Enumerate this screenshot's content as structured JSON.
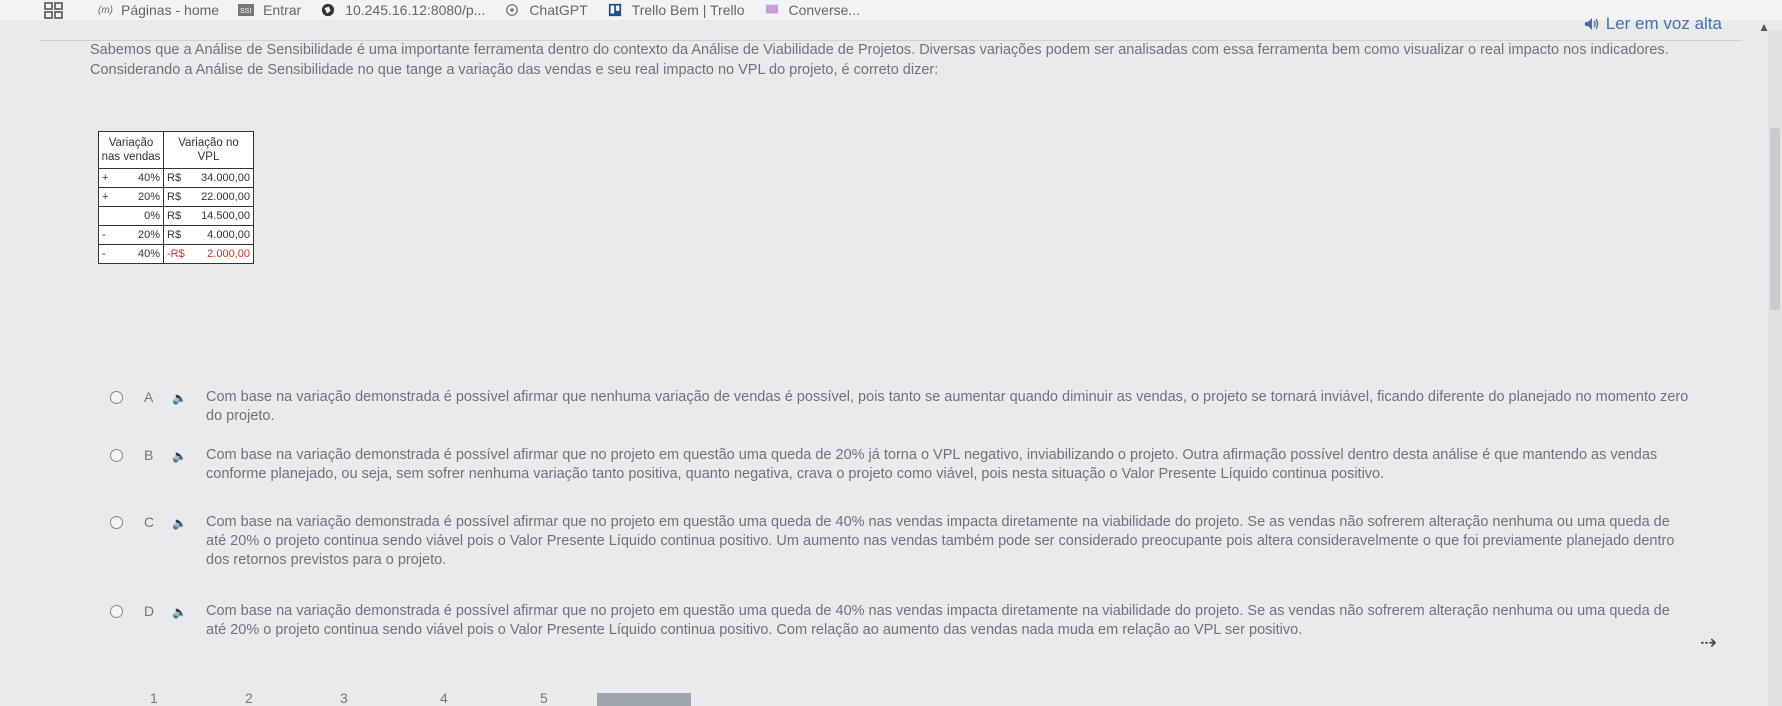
{
  "bookmarks": {
    "items": [
      {
        "label": "Páginas - home",
        "prefix": "(m)"
      },
      {
        "label": "Entrar"
      },
      {
        "label": "10.245.16.12:8080/p..."
      },
      {
        "label": "ChatGPT"
      },
      {
        "label": "Trello Bem | Trello"
      },
      {
        "label": "Converse..."
      }
    ]
  },
  "header": {
    "read_aloud": "Ler em voz alta"
  },
  "question": {
    "text": "Sabemos que a Análise de Sensibilidade é uma importante ferramenta dentro do contexto da Análise de Viabilidade de Projetos. Diversas variações podem ser analisadas com essa ferramenta bem como visualizar o real impacto nos indicadores. Considerando a Análise de Sensibilidade no que tange a variação das vendas e seu real impacto no VPL do projeto, é correto dizer:"
  },
  "table": {
    "headers": [
      "Variação nas vendas",
      "Variação no VPL"
    ],
    "rows": [
      {
        "sign": "+",
        "pct": "40%",
        "cur": "R$",
        "val": "34.000,00",
        "negative": false
      },
      {
        "sign": "+",
        "pct": "20%",
        "cur": "R$",
        "val": "22.000,00",
        "negative": false
      },
      {
        "sign": "",
        "pct": "0%",
        "cur": "R$",
        "val": "14.500,00",
        "negative": false
      },
      {
        "sign": "-",
        "pct": "20%",
        "cur": "R$",
        "val": "4.000,00",
        "negative": false
      },
      {
        "sign": "-",
        "pct": "40%",
        "cur": "-R$",
        "val": "2.000,00",
        "negative": true
      }
    ]
  },
  "options": [
    {
      "letter": "A",
      "text": "Com base na variação demonstrada é possível afirmar que nenhuma variação de vendas é possível, pois tanto se aumentar quando diminuir as vendas, o projeto se tornará inviável, ficando diferente do planejado no momento zero do projeto."
    },
    {
      "letter": "B",
      "text": "Com base na variação demonstrada é possível afirmar que no projeto em questão uma queda de 20% já torna o VPL negativo, inviabilizando o projeto. Outra afirmação possível dentro desta análise é que mantendo as vendas conforme planejado, ou seja, sem sofrer nenhuma variação tanto positiva, quanto negativa, crava o projeto como viável, pois nesta situação o Valor Presente Líquido continua positivo."
    },
    {
      "letter": "C",
      "text": "Com base na variação demonstrada é possível afirmar que no projeto em questão uma queda de 40% nas vendas impacta diretamente na viabilidade do projeto. Se as vendas não sofrerem alteração nenhuma ou uma queda de até 20% o projeto continua sendo viável pois o Valor Presente Líquido continua positivo. Um aumento nas vendas também pode ser considerado preocupante pois altera consideravelmente o que foi previamente planejado dentro dos retornos previstos para o projeto."
    },
    {
      "letter": "D",
      "text": "Com base na variação demonstrada é possível afirmar que no projeto em questão uma queda de 40% nas vendas impacta diretamente na viabilidade do projeto. Se as vendas não sofrerem alteração nenhuma ou uma queda de até 20% o projeto continua sendo viável pois o Valor Presente Líquido continua positivo. Com relação ao aumento das vendas nada muda em relação ao VPL ser positivo."
    }
  ],
  "pagination": [
    "1",
    "2",
    "3",
    "4",
    "5"
  ]
}
